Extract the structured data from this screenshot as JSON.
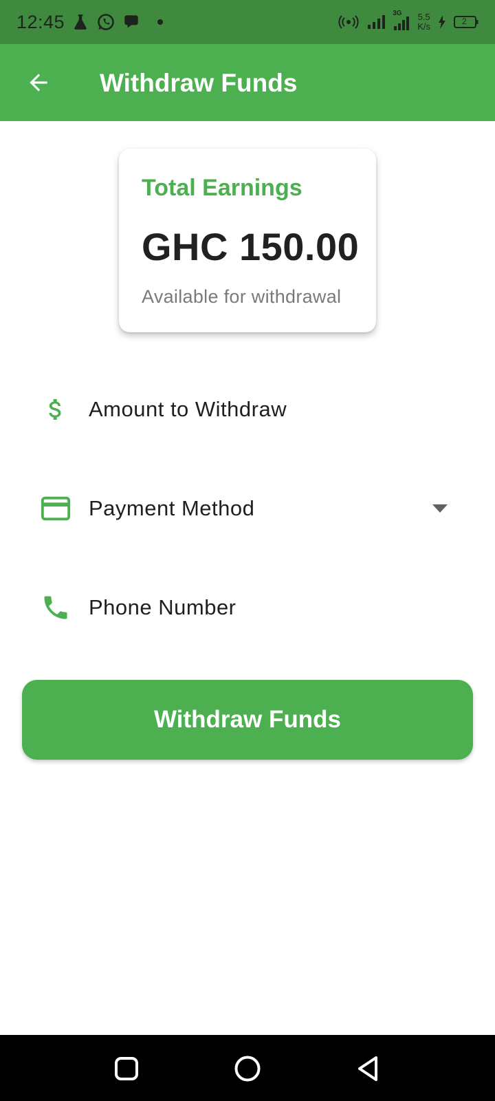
{
  "status_bar": {
    "time": "12:45",
    "network_type": "3G",
    "speed_value": "5.5",
    "speed_unit": "K/s",
    "battery_level": "2",
    "icons": [
      "flask-icon",
      "whatsapp-icon",
      "chat-bubble-icon",
      "dot-icon",
      "hotspot-icon",
      "signal-icon",
      "signal-3g-icon",
      "charging-icon",
      "battery-icon"
    ]
  },
  "app_bar": {
    "title": "Withdraw Funds",
    "back_icon": "arrow-back-icon"
  },
  "earnings_card": {
    "title": "Total Earnings",
    "amount": "GHC 150.00",
    "subtitle": "Available for withdrawal"
  },
  "form": {
    "amount_field": {
      "label": "Amount to Withdraw",
      "icon": "dollar-icon"
    },
    "payment_field": {
      "label": "Payment Method",
      "icon": "credit-card-icon",
      "arrow": "dropdown-arrow-icon"
    },
    "phone_field": {
      "label": "Phone Number",
      "icon": "phone-icon"
    }
  },
  "submit_button": {
    "label": "Withdraw Funds"
  },
  "colors": {
    "primary": "#4caf50",
    "status_bar": "#3f8a3e",
    "text_dark": "#212121",
    "text_muted": "#7a7a7a"
  }
}
